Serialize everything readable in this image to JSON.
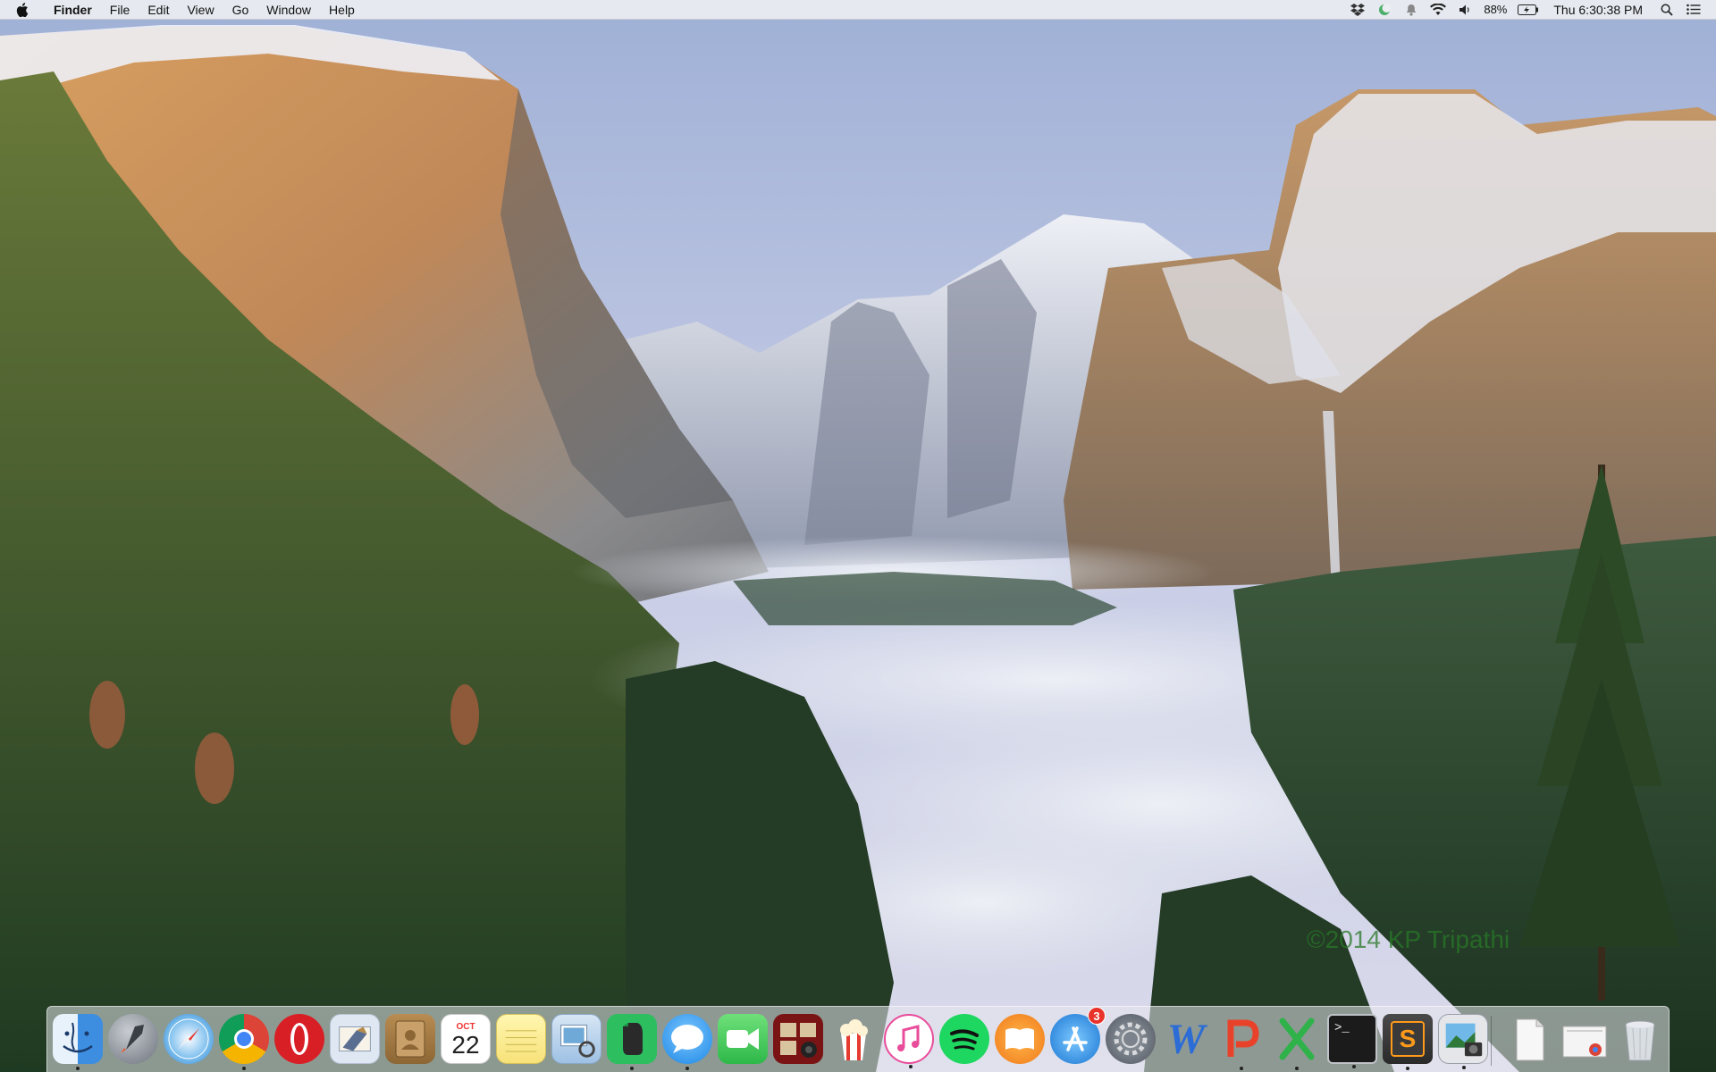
{
  "menubar": {
    "app_name": "Finder",
    "menus": [
      "File",
      "Edit",
      "View",
      "Go",
      "Window",
      "Help"
    ],
    "status_icons": [
      "dropbox-icon",
      "moon-icon",
      "notification-icon",
      "wifi-icon",
      "volume-icon"
    ],
    "battery_percent": "88%",
    "clock": "Thu 6:30:38 PM",
    "right_icons": [
      "spotlight-icon",
      "notification-center-icon"
    ]
  },
  "wallpaper": {
    "credit": "©2014 KP Tripathi"
  },
  "dock": {
    "items": [
      {
        "name": "Finder",
        "icon": "finder-icon",
        "running": true
      },
      {
        "name": "Launchpad",
        "icon": "launchpad-icon",
        "running": false
      },
      {
        "name": "Safari",
        "icon": "safari-icon",
        "running": false
      },
      {
        "name": "Google Chrome",
        "icon": "chrome-icon",
        "running": true
      },
      {
        "name": "Opera",
        "icon": "opera-icon",
        "running": false
      },
      {
        "name": "Mail",
        "icon": "mail-icon",
        "running": false
      },
      {
        "name": "Contacts",
        "icon": "contacts-icon",
        "running": false
      },
      {
        "name": "Calendar",
        "icon": "calendar-icon",
        "running": false,
        "month": "OCT",
        "day": "22"
      },
      {
        "name": "Notes",
        "icon": "notes-icon",
        "running": false
      },
      {
        "name": "Preview",
        "icon": "preview-icon",
        "running": false
      },
      {
        "name": "Evernote",
        "icon": "evernote-icon",
        "running": true
      },
      {
        "name": "Messages",
        "icon": "messages-icon",
        "running": true
      },
      {
        "name": "FaceTime",
        "icon": "facetime-icon",
        "running": false
      },
      {
        "name": "Photo Booth",
        "icon": "photo-booth-icon",
        "running": false
      },
      {
        "name": "Popcorn Time",
        "icon": "popcorn-icon",
        "running": false
      },
      {
        "name": "iTunes",
        "icon": "itunes-icon",
        "running": true
      },
      {
        "name": "Spotify",
        "icon": "spotify-icon",
        "running": false
      },
      {
        "name": "iBooks",
        "icon": "ibooks-icon",
        "running": false
      },
      {
        "name": "App Store",
        "icon": "app-store-icon",
        "running": false,
        "badge": "3"
      },
      {
        "name": "System Preferences",
        "icon": "system-preferences-icon",
        "running": false
      },
      {
        "name": "Microsoft Word",
        "icon": "word-icon",
        "running": false
      },
      {
        "name": "Microsoft PowerPoint",
        "icon": "powerpoint-icon",
        "running": true
      },
      {
        "name": "Microsoft Excel",
        "icon": "excel-icon",
        "running": true
      },
      {
        "name": "Terminal",
        "icon": "terminal-icon",
        "running": true
      },
      {
        "name": "Sublime Text",
        "icon": "sublime-text-icon",
        "running": true
      },
      {
        "name": "Image Capture",
        "icon": "image-capture-icon",
        "running": true
      }
    ],
    "stack_items": [
      {
        "name": "Documents",
        "icon": "document-stack-icon"
      },
      {
        "name": "Downloads",
        "icon": "downloads-stack-icon"
      },
      {
        "name": "Trash",
        "icon": "trash-icon"
      }
    ],
    "calendar_month": "OCT",
    "calendar_day": "22",
    "app_store_badge": "3",
    "terminal_prompt": ">_",
    "sublime_letter": "S",
    "word_letter": "W"
  }
}
